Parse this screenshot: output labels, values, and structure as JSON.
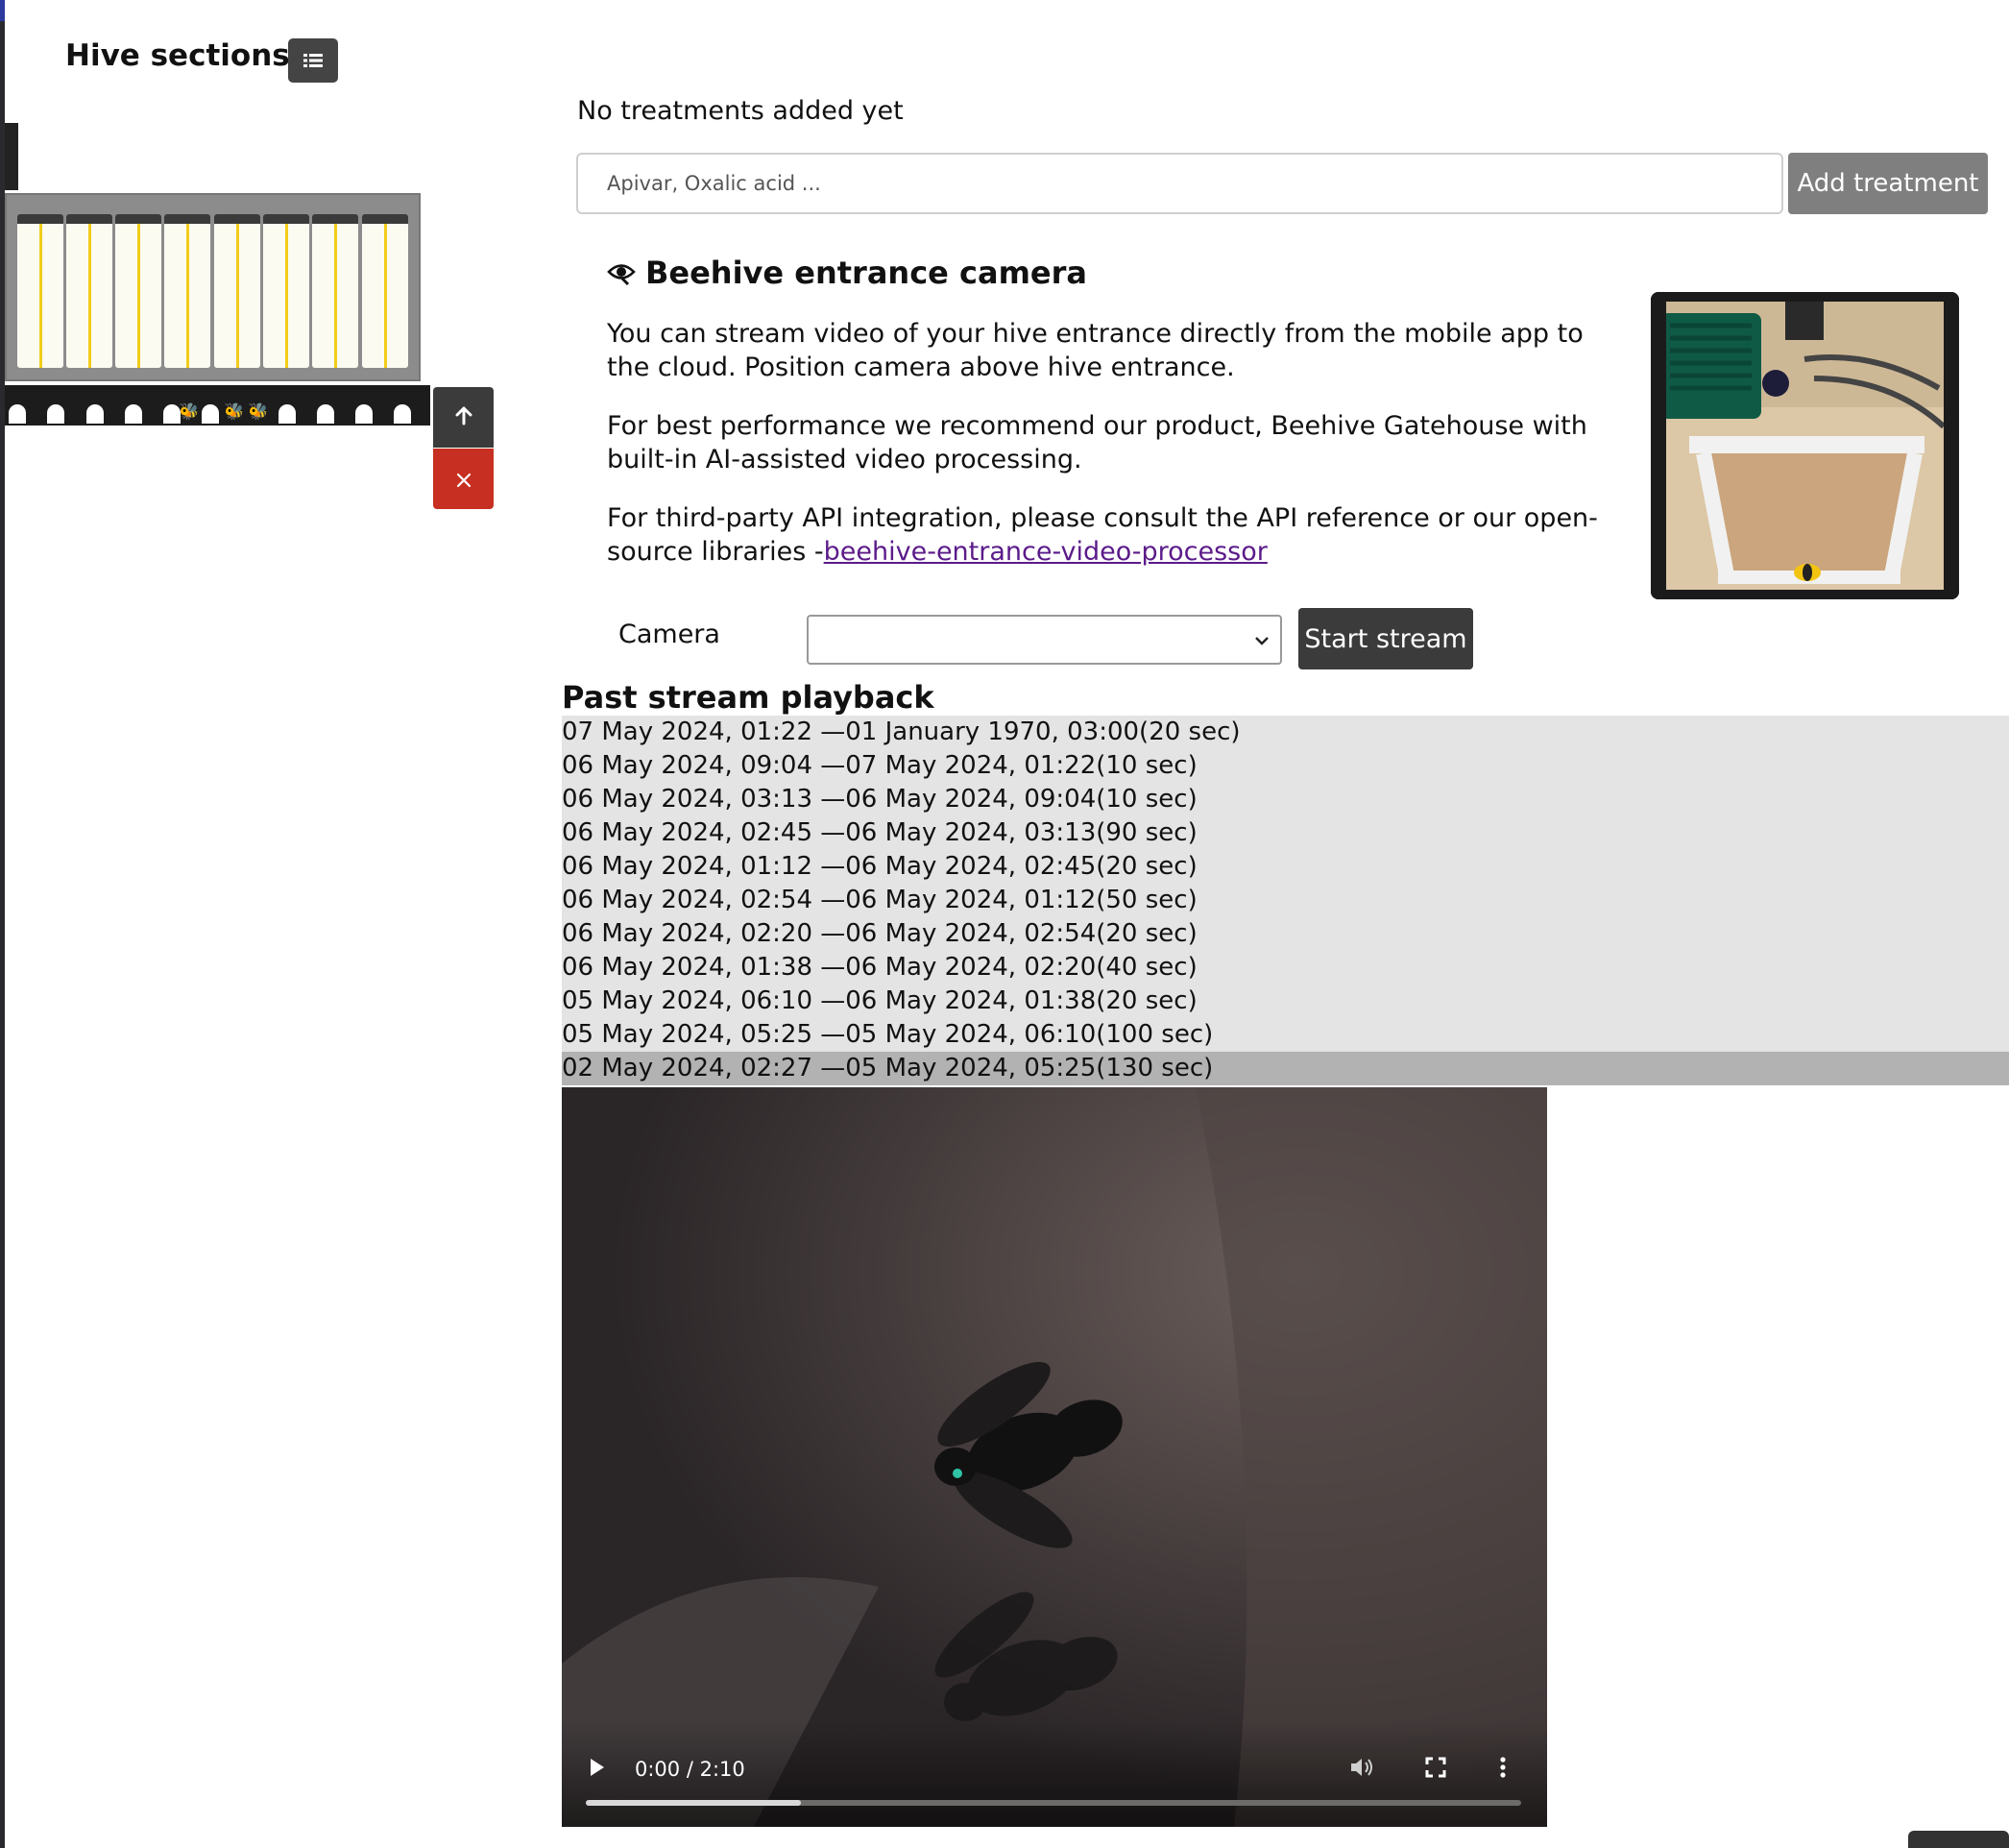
{
  "hive_sections": {
    "title": "Hive sections",
    "list_icon": "list-icon",
    "move_up_icon": "arrow-up-icon",
    "remove_icon": "close-icon"
  },
  "treatments": {
    "empty_text": "No treatments added yet",
    "input_placeholder": "Apivar, Oxalic acid ...",
    "add_button": "Add treatment"
  },
  "camera": {
    "title": "Beehive entrance camera",
    "paragraph1": "You can stream video of your hive entrance directly from the mobile app to the cloud. Position camera above hive entrance.",
    "paragraph2": "For best performance we recommend our product, Beehive Gatehouse with built-in AI-assisted video processing.",
    "paragraph3_prefix": "For third-party API integration, please consult the API reference or our open-source libraries -",
    "paragraph3_link": "beehive-entrance-video-processor",
    "camera_label": "Camera",
    "camera_selected": "",
    "start_button": "Start stream"
  },
  "playback": {
    "title": "Past stream playback",
    "streams": [
      "07 May 2024, 01:22 —01 January 1970, 03:00(20 sec)",
      "06 May 2024, 09:04 —07 May 2024, 01:22(10 sec)",
      "06 May 2024, 03:13 —06 May 2024, 09:04(10 sec)",
      "06 May 2024, 02:45 —06 May 2024, 03:13(90 sec)",
      "06 May 2024, 01:12 —06 May 2024, 02:45(20 sec)",
      "06 May 2024, 02:54 —06 May 2024, 01:12(50 sec)",
      "06 May 2024, 02:20 —06 May 2024, 02:54(20 sec)",
      "06 May 2024, 01:38 —06 May 2024, 02:20(40 sec)",
      "05 May 2024, 06:10 —06 May 2024, 01:38(20 sec)",
      "05 May 2024, 05:25 —05 May 2024, 06:10(100 sec)",
      "02 May 2024, 02:27 —05 May 2024, 05:25(130 sec)"
    ],
    "selected_index": 10,
    "video": {
      "time": "0:00 / 2:10",
      "progress": 0.23
    }
  }
}
